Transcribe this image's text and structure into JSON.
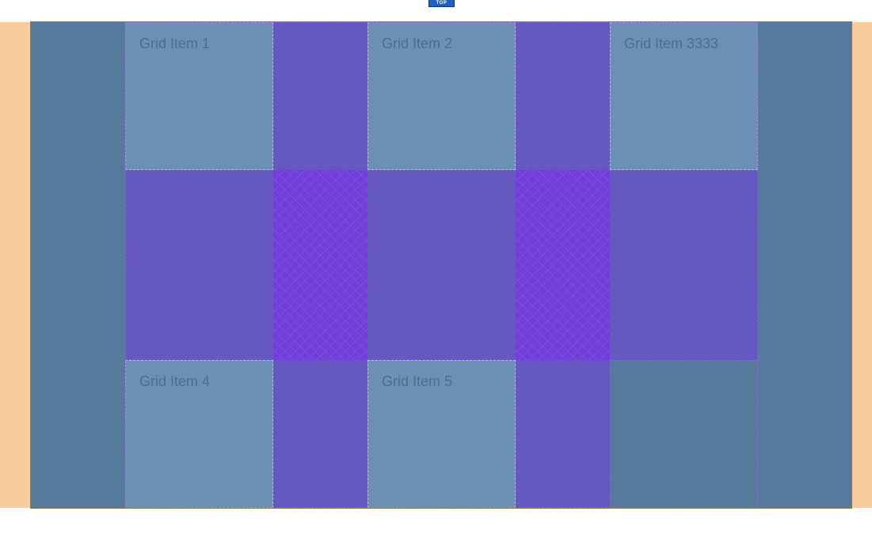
{
  "top_badge": {
    "label": "TOP"
  },
  "grid": {
    "items": [
      {
        "label": "Grid Item 1"
      },
      {
        "label": "Grid Item 2"
      },
      {
        "label": "Grid Item 3333"
      },
      {
        "label": "Grid Item 4"
      },
      {
        "label": "Grid Item 5"
      }
    ]
  },
  "colors": {
    "container_background": "#567a9c",
    "padding_highlight": "#f9cc9d",
    "item_background": "#6b90b4",
    "gap_overlay": "#6e46d2",
    "badge": "#1f5fbf"
  }
}
